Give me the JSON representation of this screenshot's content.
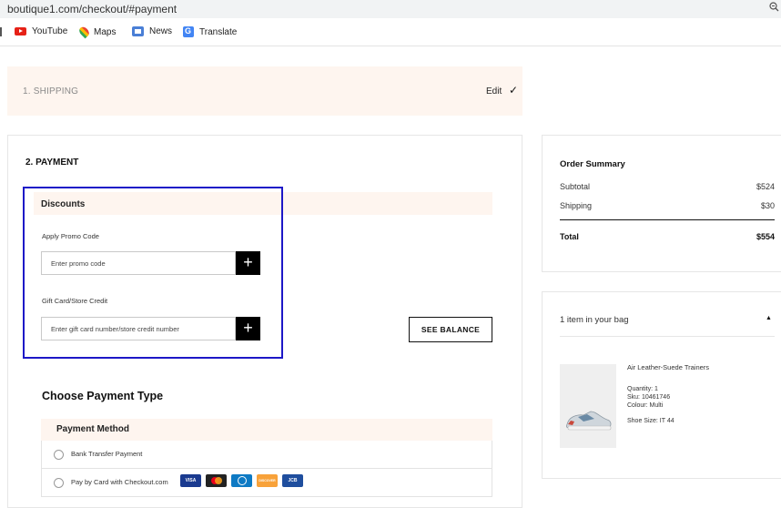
{
  "browser": {
    "url": "boutique1.com/checkout/#payment",
    "zoom_icon": "magnifier-minus-icon",
    "bookmarks": [
      {
        "label": "YouTube",
        "icon": "youtube-icon"
      },
      {
        "label": "Maps",
        "icon": "maps-pin-icon"
      },
      {
        "label": "News",
        "icon": "news-icon"
      },
      {
        "label": "Translate",
        "icon": "translate-icon"
      }
    ]
  },
  "shipping": {
    "label": "1. SHIPPING",
    "edit_label": "Edit",
    "check_glyph": "✓"
  },
  "payment": {
    "title": "2. PAYMENT",
    "discounts_title": "Discounts",
    "promo_label": "Apply Promo Code",
    "promo_placeholder": "Enter promo code",
    "gift_label": "Gift Card/Store Credit",
    "gift_placeholder": "Enter gift card number/store credit number",
    "add_glyph": "+",
    "see_balance_label": "SEE BALANCE",
    "choose_title": "Choose Payment Type",
    "method_title": "Payment Method",
    "methods": [
      {
        "label": "Bank Transfer Payment"
      },
      {
        "label": "Pay by Card with Checkout.com"
      }
    ],
    "card_logos": [
      {
        "name": "visa-logo",
        "text": "VISA"
      },
      {
        "name": "mastercard-logo",
        "text": ""
      },
      {
        "name": "diners-logo",
        "text": ""
      },
      {
        "name": "discover-logo",
        "text": "DISCOVER"
      },
      {
        "name": "jcb-logo",
        "text": "JCB"
      }
    ],
    "highlight_color": "#1d18c7",
    "accent_bg": "#fef5ef"
  },
  "summary": {
    "title": "Order Summary",
    "rows": [
      {
        "label": "Subtotal",
        "value": "$524"
      },
      {
        "label": "Shipping",
        "value": "$30"
      }
    ],
    "total_label": "Total",
    "total_value": "$554"
  },
  "bag": {
    "title": "1 item in your bag",
    "caret": "▲",
    "product": {
      "name": "Air Leather-Suede Trainers",
      "quantity": "Quantity: 1",
      "sku": "Sku: 10461746",
      "colour": "Colour: Multi",
      "size": "Shoe Size: IT 44"
    }
  }
}
